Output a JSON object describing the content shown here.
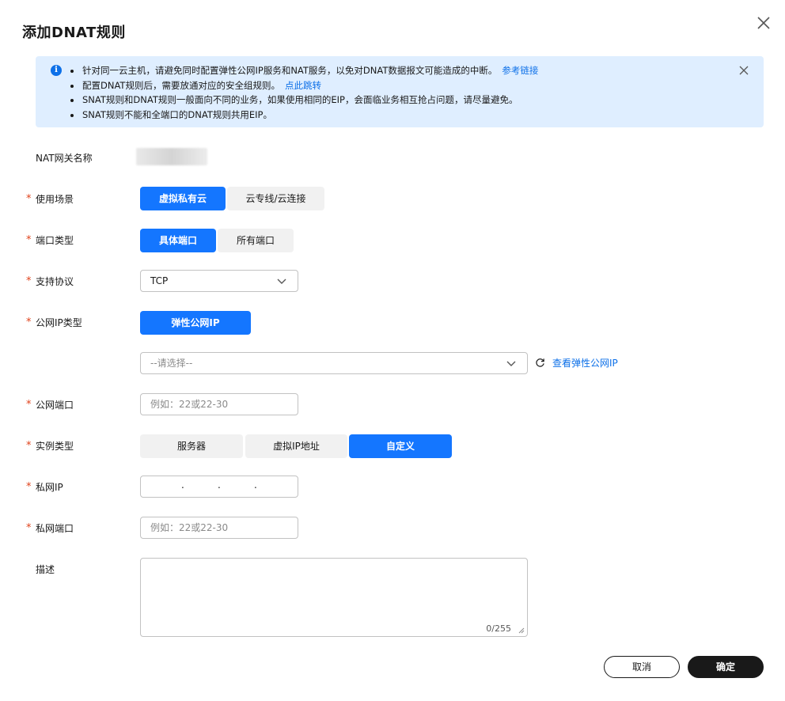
{
  "dialog": {
    "title": "添加DNAT规则"
  },
  "alert": {
    "items": [
      {
        "text": "针对同一云主机，请避免同时配置弹性公网IP服务和NAT服务，以免对DNAT数据报文可能造成的中断。",
        "link": "参考链接"
      },
      {
        "text": "配置DNAT规则后，需要放通对应的安全组规则。",
        "link": "点此跳转"
      },
      {
        "text": "SNAT规则和DNAT规则一般面向不同的业务，如果使用相同的EIP，会面临业务相互抢占问题，请尽量避免。",
        "link": null
      },
      {
        "text": "SNAT规则不能和全端口的DNAT规则共用EIP。",
        "link": null
      }
    ]
  },
  "form": {
    "nat_gateway_name": {
      "label": "NAT网关名称"
    },
    "scenario": {
      "label": "使用场景",
      "options": [
        "虚拟私有云",
        "云专线/云连接"
      ],
      "selected": "虚拟私有云"
    },
    "port_type": {
      "label": "端口类型",
      "options": [
        "具体端口",
        "所有端口"
      ],
      "selected": "具体端口"
    },
    "protocol": {
      "label": "支持协议",
      "value": "TCP"
    },
    "public_ip_type": {
      "label": "公网IP类型",
      "options": [
        "弹性公网IP"
      ],
      "selected": "弹性公网IP"
    },
    "eip_select": {
      "placeholder": "--请选择--",
      "link": "查看弹性公网IP"
    },
    "public_port": {
      "label": "公网端口",
      "placeholder": "例如：22或22-30"
    },
    "instance_type": {
      "label": "实例类型",
      "options": [
        "服务器",
        "虚拟IP地址",
        "自定义"
      ],
      "selected": "自定义"
    },
    "private_ip": {
      "label": "私网IP",
      "separator": "."
    },
    "private_port": {
      "label": "私网端口",
      "placeholder": "例如：22或22-30"
    },
    "description": {
      "label": "描述",
      "counter": "0/255"
    },
    "required_mark": "*"
  },
  "footer": {
    "cancel": "取消",
    "confirm": "确定"
  },
  "colors": {
    "primary": "#1476ff",
    "link": "#0d70e8",
    "required": "#e0421b",
    "alert_bg": "#dfeeff",
    "confirm_bg": "#191919"
  }
}
